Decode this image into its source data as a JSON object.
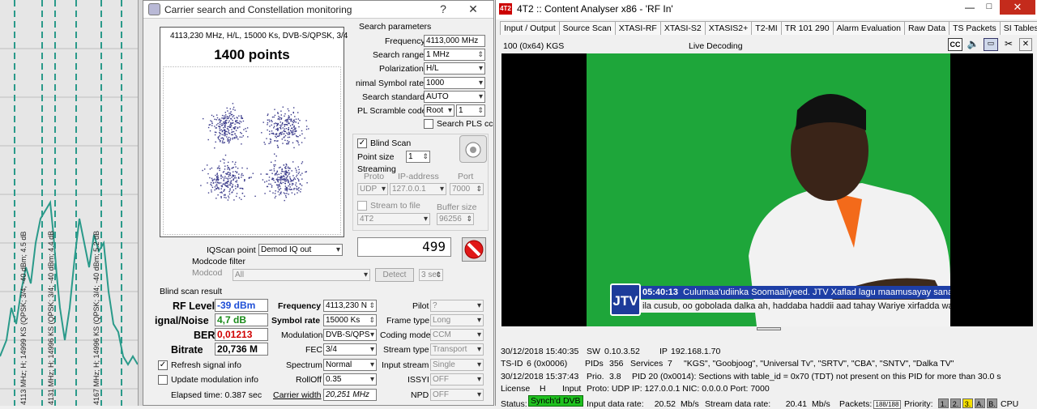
{
  "spectrum": {
    "labels": [
      "4113 MHz; H; 14999 KS (QPSK; 3/4; -40 dBm; 4.5 dB",
      "4131 MHz; H; 14996 KS (QPSK; 3/4; -40 dBm; 4.4 dB",
      "4167 MHz; H; 14996 KS (QPSK; 3/4; -40 dBm; 5.2 dB"
    ]
  },
  "carrier": {
    "title": "Carrier search and Constellation monitoring",
    "help": "?",
    "close": "✕",
    "constellation": {
      "info": "4113,230 MHz, H/L, 15000 Ks, DVB-S/QPSK, 3/4",
      "points_label": "1400 points"
    },
    "search": {
      "header": "Search parameters",
      "frequency_label": "Frequency",
      "frequency_value": "4113,000 MHz",
      "range_label": "Search range",
      "range_value": "1 MHz",
      "polarization_label": "Polarization",
      "polarization_value": "H/L",
      "minsym_label": "nimal Symbol rate",
      "minsym_value": "1000",
      "standard_label": "Search standard",
      "standard_value": "AUTO",
      "plscramble_label": "PL Scramble code",
      "plscramble_mode": "Root",
      "plscramble_value": "1",
      "searchpls_label": "Search PLS cc"
    },
    "blind": {
      "blindscan_label": "Blind Scan",
      "pointsize_label": "Point size",
      "pointsize_value": "1",
      "streaming_label": "Streaming",
      "proto_label": "Proto",
      "ip_label": "IP-address",
      "port_label": "Port",
      "proto_value": "UDP",
      "ip_value": "127.0.0.1",
      "port_value": "7000",
      "streamfile_label": "Stream to file",
      "buffer_label": "Buffer size",
      "file_value": "4T2",
      "buffer_value": "96256"
    },
    "counter": "499",
    "iqscan_label": "IQScan point",
    "iqscan_value": "Demod IQ out",
    "modcode_filter_label": "Modcode filter",
    "modcode_label": "Modcod",
    "modcode_value": "All",
    "detect_label": "Detect",
    "detect_sec": "3 sec",
    "result": {
      "header": "Blind scan result",
      "rf_label": "RF Level",
      "rf_value": "-39 dBm",
      "sn_label": "ignal/Noise",
      "sn_value": "4,7 dB",
      "ber_label": "BER",
      "ber_value": "0,01213",
      "bitrate_label": "Bitrate",
      "bitrate_value": "20,736 M",
      "freq_label": "Frequency",
      "freq_value": "4113,230 N",
      "symrate_label": "Symbol rate",
      "symrate_value": "15000 Ks",
      "modulation_label": "Modulation",
      "modulation_value": "DVB-S/QPS",
      "fec_label": "FEC",
      "fec_value": "3/4",
      "spectrum_label": "Spectrum",
      "spectrum_value": "Normal",
      "rolloff_label": "RollOff",
      "rolloff_value": "0.35",
      "carrierwidth_label": "Carrier width",
      "carrierwidth_value": "20,251 MHz",
      "pilot_label": "Pilot",
      "pilot_value": "?",
      "frametype_label": "Frame type",
      "frametype_value": "Long",
      "codingmode_label": "Coding mode",
      "codingmode_value": "CCM",
      "streamtype_label": "Stream type",
      "streamtype_value": "Transport",
      "inputstream_label": "Input stream",
      "inputstream_value": "Single",
      "issyi_label": "ISSYI",
      "issyi_value": "OFF",
      "npd_label": "NPD",
      "npd_value": "OFF",
      "refresh_label": "Refresh signal info",
      "update_label": "Update modulation info",
      "elapsed": "Elapsed time: 0.387 sec"
    }
  },
  "analyser": {
    "title": "4T2 :: Content Analyser x86  - 'RF In'",
    "logo": "4T2",
    "tabs": [
      "Input / Output",
      "Source Scan",
      "XTASI-RF",
      "XTASI-S2",
      "XTASIS2+",
      "T2-MI",
      "TR 101 290",
      "Alarm Evaluation",
      "Raw Data",
      "TS Packets",
      "SI Tables"
    ],
    "service": "100 (0x64) KGS",
    "live": "Live Decoding",
    "overlay": {
      "channel": "JTV",
      "time": "05:40:13",
      "ticker1": "Culumaa'udiinka Soomaaliyeed. JTV Xaflad lagu maamusayay sanadc",
      "ticker2": "ila cusub, oo gobolada dalka ah, haddaba haddii aad tahay Wariye xirfadda war"
    },
    "info": {
      "r1_time": "30/12/2018 15:40:35",
      "r1_sw_label": "SW",
      "r1_sw": "0.10.3.52",
      "r1_ip_label": "IP",
      "r1_ip": "192.168.1.70",
      "r2_tsid_label": "TS-ID",
      "r2_tsid": "6 (0x0006)",
      "r2_pids_label": "PIDs",
      "r2_pids": "356",
      "r2_services_label": "Services",
      "r2_services": "7",
      "r2_list": "\"KGS\", \"Goobjoog\", \"Universal Tv\", \"SRTV\", \"CBA\", \"SNTV\", \"Dalka TV\"",
      "r3_time": "30/12/2018 15:37:43",
      "r3_prio_label": "Prio.",
      "r3_prio": "3.8",
      "r3_msg": "PID 20 (0x0014): Sections with table_id = 0x70 (TDT) not present on this PID for more than 30.0 s",
      "r4_license": "License",
      "r4_h": "H",
      "r4_input": "Input",
      "r4_proto": "Proto: UDP IP: 127.0.0.1 NIC: 0.0.0.0 Port: 7000",
      "r5_status_label": "Status:",
      "r5_status": "Synch'd DVB",
      "r5_idr_label": "Input data rate:",
      "r5_idr": "20.52",
      "r5_unit1": "Mb/s",
      "r5_sdr_label": "Stream data rate:",
      "r5_sdr": "20.41",
      "r5_unit2": "Mb/s",
      "r5_packets_label": "Packets:",
      "r5_packets": "188/188",
      "r5_priority_label": "Priority:",
      "r5_p1": "1.",
      "r5_p2": "2.",
      "r5_p3": "3.",
      "r5_pa": "A.",
      "r5_pb": "B.",
      "r5_cpu_label": "CPU"
    }
  },
  "colors": {
    "status_green": "#1fc11f",
    "rf_blue": "#1f4fd6",
    "sn_green": "#1a8a1a",
    "ber_red": "#d00000",
    "video_green": "#1ea63a",
    "spectrum_line": "#2a9a8a"
  }
}
